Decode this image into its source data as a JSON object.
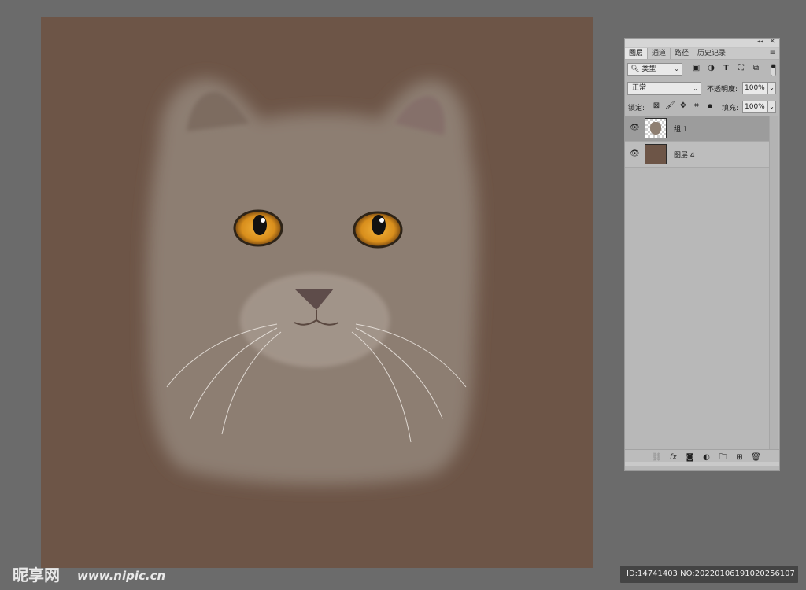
{
  "canvas": {
    "background": "#6d5547",
    "image": "british-shorthair-cat-photo"
  },
  "panel": {
    "tabs": [
      "图层",
      "通道",
      "路径",
      "历史记录"
    ],
    "active_tab": 0,
    "filter": {
      "value": "类型"
    },
    "filter_icons": [
      "pixel-filter-icon",
      "adjustment-filter-icon",
      "type-filter-icon",
      "shape-filter-icon",
      "smartobject-filter-icon"
    ],
    "blend_mode": "正常",
    "opacity_label": "不透明度:",
    "opacity_value": "100%",
    "lock_label": "锁定:",
    "fill_label": "填充:",
    "fill_value": "100%",
    "layers": [
      {
        "name": "组 1",
        "visible": true,
        "selected": true,
        "thumb": "cat"
      },
      {
        "name": "图层 4",
        "visible": true,
        "selected": false,
        "thumb": "fill"
      }
    ]
  },
  "watermark": {
    "logo_text": "昵享网 www.nipic.cn",
    "id_text": "ID:14741403 NO:20220106191020256107"
  },
  "colors": {
    "workspace": "#6b6b6b",
    "canvas_fill": "#6d5547",
    "panel": "#b8b8b8",
    "selected_layer": "#9c9c9c"
  }
}
